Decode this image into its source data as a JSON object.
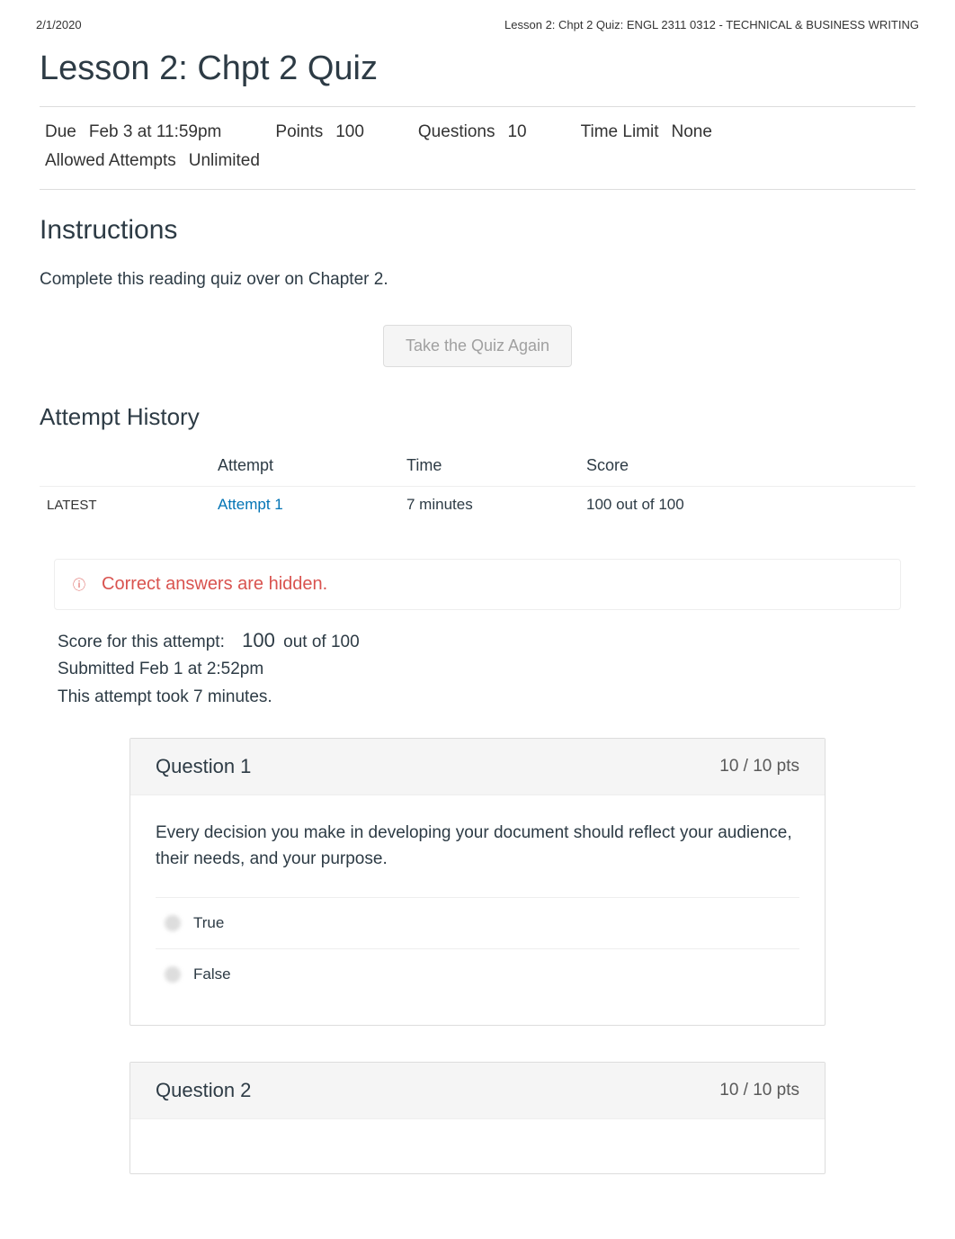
{
  "print_header": {
    "date": "2/1/2020",
    "title": "Lesson 2: Chpt 2 Quiz: ENGL 2311 0312 - TECHNICAL & BUSINESS WRITING"
  },
  "page_title": "Lesson 2: Chpt 2 Quiz",
  "meta": {
    "due_label": "Due",
    "due_value": "Feb 3 at 11:59pm",
    "points_label": "Points",
    "points_value": "100",
    "questions_label": "Questions",
    "questions_value": "10",
    "time_limit_label": "Time Limit",
    "time_limit_value": "None",
    "allowed_label": "Allowed Attempts",
    "allowed_value": "Unlimited"
  },
  "instructions": {
    "heading": "Instructions",
    "body": "Complete this reading quiz over on Chapter 2."
  },
  "take_again_label": "Take the Quiz Again",
  "attempt_history": {
    "heading": "Attempt History",
    "headers": {
      "attempt": "Attempt",
      "time": "Time",
      "score": "Score"
    },
    "rows": [
      {
        "tag": "LATEST",
        "attempt": "Attempt 1",
        "time": "7 minutes",
        "score": "100 out of 100"
      }
    ]
  },
  "hidden_answers": {
    "icon": "ⓘ",
    "text": "Correct answers are hidden."
  },
  "score_info": {
    "label": "Score for this attempt:",
    "score": "100",
    "out_of": "out of 100",
    "submitted": "Submitted Feb 1 at 2:52pm",
    "took": "This attempt took 7 minutes."
  },
  "questions": [
    {
      "title": "Question 1",
      "pts": "10 / 10 pts",
      "text": "Every decision you make in developing your document should reflect your audience, their needs, and your purpose.",
      "answers": [
        "True",
        "False"
      ]
    },
    {
      "title": "Question 2",
      "pts": "10 / 10 pts",
      "text": "",
      "answers": []
    }
  ]
}
